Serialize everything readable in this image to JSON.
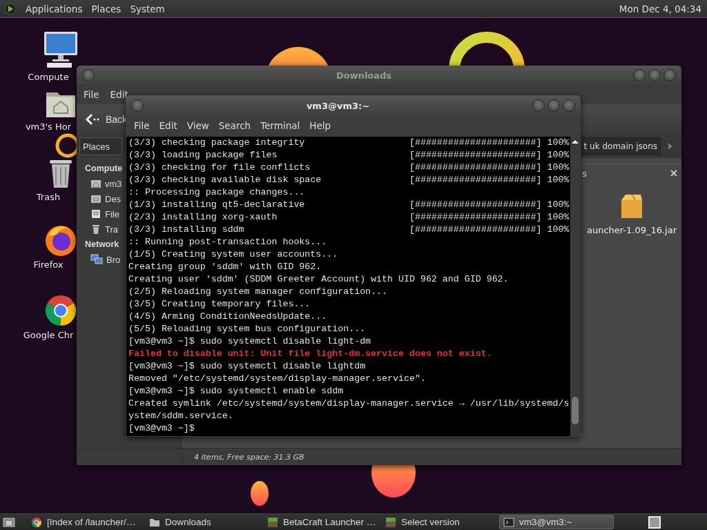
{
  "top_panel": {
    "menus": [
      "Applications",
      "Places",
      "System"
    ],
    "clock": "Mon Dec 4, 04:34"
  },
  "desktop_icons": [
    {
      "label": "Compute",
      "kind": "computer"
    },
    {
      "label": "vm3's Hor",
      "kind": "home"
    },
    {
      "label": "Trash",
      "kind": "trash"
    },
    {
      "label": "Firefox",
      "kind": "firefox"
    },
    {
      "label": "Google Chr",
      "kind": "chrome"
    }
  ],
  "file_manager": {
    "title": "Downloads",
    "menu": [
      "File",
      "Edit"
    ],
    "back": "Back",
    "places": "Places",
    "crumb": "t uk domain jsons",
    "sidebar": [
      {
        "heading": "Compute",
        "items": [
          {
            "label": "vm3",
            "kind": "home"
          },
          {
            "label": "Des",
            "kind": "desktop"
          },
          {
            "label": "File",
            "kind": "drive"
          },
          {
            "label": "Tra",
            "kind": "trash"
          }
        ]
      },
      {
        "heading": "Network",
        "items": [
          {
            "label": "Bro",
            "kind": "network"
          }
        ]
      }
    ],
    "pane_title": "s",
    "files": [
      {
        "name": "auncher-1.09_16.jar",
        "kind": "package"
      }
    ],
    "status": "4 items, Free space: 31.3 GB"
  },
  "terminal": {
    "title": "vm3@vm3:~",
    "menu": [
      "File",
      "Edit",
      "View",
      "Search",
      "Terminal",
      "Help"
    ],
    "lines": [
      {
        "kind": "progress",
        "text": "(3/3) checking package integrity",
        "bar": "[######################]",
        "percent": "100%"
      },
      {
        "kind": "progress",
        "text": "(3/3) loading package files",
        "bar": "[######################]",
        "percent": "100%"
      },
      {
        "kind": "progress",
        "text": "(3/3) checking for file conflicts",
        "bar": "[######################]",
        "percent": "100%"
      },
      {
        "kind": "progress",
        "text": "(3/3) checking available disk space",
        "bar": "[######################]",
        "percent": "100%"
      },
      {
        "kind": "normal",
        "text": ":: Processing package changes..."
      },
      {
        "kind": "progress",
        "text": "(1/3) installing qt5-declarative",
        "bar": "[######################]",
        "percent": "100%"
      },
      {
        "kind": "progress",
        "text": "(2/3) installing xorg-xauth",
        "bar": "[######################]",
        "percent": "100%"
      },
      {
        "kind": "progress",
        "text": "(3/3) installing sddm",
        "bar": "[######################]",
        "percent": "100%"
      },
      {
        "kind": "normal",
        "text": ":: Running post-transaction hooks..."
      },
      {
        "kind": "normal",
        "text": "(1/5) Creating system user accounts..."
      },
      {
        "kind": "normal",
        "text": "Creating group 'sddm' with GID 962."
      },
      {
        "kind": "normal",
        "text": "Creating user 'sddm' (SDDM Greeter Account) with UID 962 and GID 962."
      },
      {
        "kind": "normal",
        "text": "(2/5) Reloading system manager configuration..."
      },
      {
        "kind": "normal",
        "text": "(3/5) Creating temporary files..."
      },
      {
        "kind": "normal",
        "text": "(4/5) Arming ConditionNeedsUpdate..."
      },
      {
        "kind": "normal",
        "text": "(5/5) Reloading system bus configuration..."
      },
      {
        "kind": "normal",
        "text": "[vm3@vm3 ~]$ sudo systemctl disable light-dm"
      },
      {
        "kind": "error",
        "text": "Failed to disable unit: Unit file light-dm.service does not exist."
      },
      {
        "kind": "normal",
        "text": "[vm3@vm3 ~]$ sudo systemctl disable lightdm"
      },
      {
        "kind": "normal",
        "text": "Removed \"/etc/systemd/system/display-manager.service\"."
      },
      {
        "kind": "normal",
        "text": "[vm3@vm3 ~]$ sudo systemctl enable sddm"
      },
      {
        "kind": "normal",
        "text": "Created symlink /etc/systemd/system/display-manager.service → /usr/lib/systemd/s"
      },
      {
        "kind": "normal",
        "text": "ystem/sddm.service."
      },
      {
        "kind": "normal",
        "text": "[vm3@vm3 ~]$"
      }
    ]
  },
  "taskbar": {
    "items": [
      {
        "label": "[Index of /launcher/…",
        "kind": "chrome",
        "selected": false
      },
      {
        "label": "Downloads",
        "kind": "folder",
        "selected": false
      },
      {
        "label": "BetaCraft Launcher …",
        "kind": "betacraft",
        "selected": false
      },
      {
        "label": "Select version",
        "kind": "betacraft",
        "selected": false
      },
      {
        "label": "vm3@vm3:~",
        "kind": "terminal",
        "selected": true
      }
    ]
  }
}
